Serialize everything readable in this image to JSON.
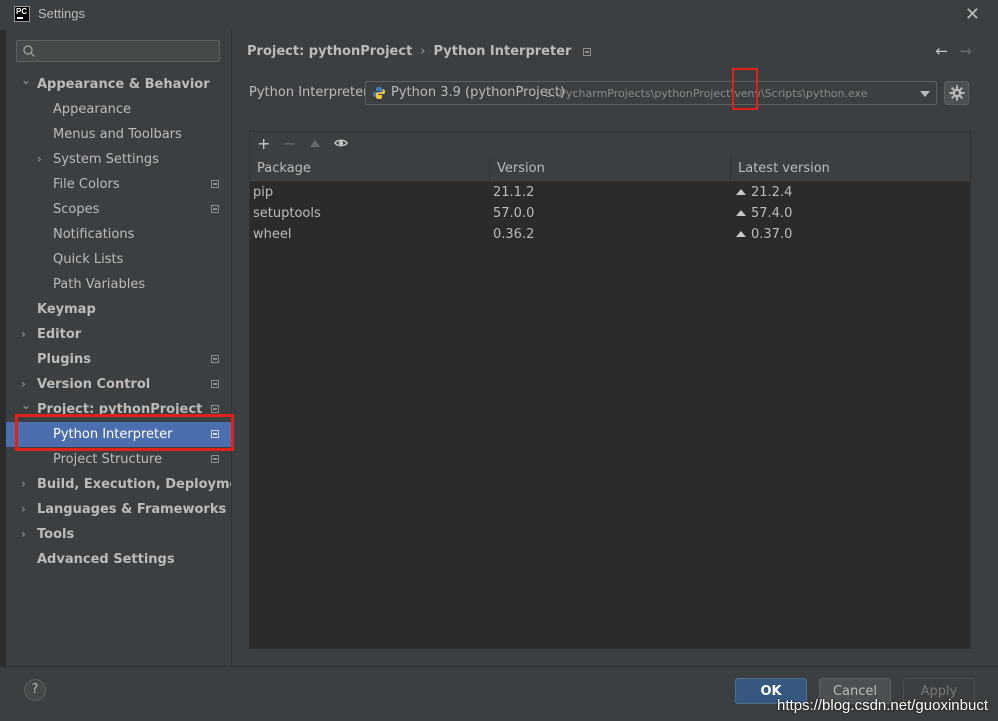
{
  "window": {
    "title": "Settings",
    "logo_text": "PC",
    "close_glyph": "✕"
  },
  "sidebar": {
    "search_placeholder": "",
    "items": [
      {
        "label": "Appearance & Behavior",
        "level": 0,
        "bold": true,
        "expanded": true
      },
      {
        "label": "Appearance",
        "level": 1
      },
      {
        "label": "Menus and Toolbars",
        "level": 1
      },
      {
        "label": "System Settings",
        "level": 1,
        "collapsible": true
      },
      {
        "label": "File Colors",
        "level": 1,
        "project_icon": true
      },
      {
        "label": "Scopes",
        "level": 1,
        "project_icon": true
      },
      {
        "label": "Notifications",
        "level": 1
      },
      {
        "label": "Quick Lists",
        "level": 1
      },
      {
        "label": "Path Variables",
        "level": 1
      },
      {
        "label": "Keymap",
        "level": 0,
        "bold": true
      },
      {
        "label": "Editor",
        "level": 0,
        "bold": true,
        "collapsible": true
      },
      {
        "label": "Plugins",
        "level": 0,
        "bold": true,
        "project_icon": true
      },
      {
        "label": "Version Control",
        "level": 0,
        "bold": true,
        "collapsible": true,
        "project_icon": true
      },
      {
        "label": "Project: pythonProject",
        "level": 0,
        "bold": true,
        "expanded": true,
        "project_icon": true
      },
      {
        "label": "Python Interpreter",
        "level": 1,
        "selected": true,
        "project_icon": true
      },
      {
        "label": "Project Structure",
        "level": 1,
        "project_icon": true
      },
      {
        "label": "Build, Execution, Deployment",
        "level": 0,
        "bold": true,
        "collapsible": true
      },
      {
        "label": "Languages & Frameworks",
        "level": 0,
        "bold": true,
        "collapsible": true
      },
      {
        "label": "Tools",
        "level": 0,
        "bold": true,
        "collapsible": true
      },
      {
        "label": "Advanced Settings",
        "level": 0,
        "bold": true
      }
    ]
  },
  "breadcrumb": {
    "project": "Project: pythonProject",
    "separator": "›",
    "page": "Python Interpreter"
  },
  "nav": {
    "back": "←",
    "forward": "→"
  },
  "interpreter": {
    "label": "Python Interpreter:",
    "name": "Python 3.9 (pythonProject)",
    "path": "E:\\PycharmProjects\\pythonProject\\venv\\Scripts\\python.exe"
  },
  "toolbar": {
    "add": "+",
    "remove": "−"
  },
  "packages": {
    "columns": [
      "Package",
      "Version",
      "Latest version"
    ],
    "rows": [
      {
        "package": "pip",
        "version": "21.1.2",
        "latest": "21.2.4"
      },
      {
        "package": "setuptools",
        "version": "57.0.0",
        "latest": "57.4.0"
      },
      {
        "package": "wheel",
        "version": "0.36.2",
        "latest": "0.37.0"
      }
    ]
  },
  "footer": {
    "help": "?",
    "ok": "OK",
    "cancel": "Cancel",
    "apply": "Apply"
  },
  "watermark": "https://blog.csdn.net/guoxinbuct",
  "colors": {
    "background": "#3c3f41",
    "selection": "#4b6eaf",
    "table_bg": "#2b2b2b",
    "highlight_box": "#e0211a",
    "ok_button": "#365880"
  }
}
